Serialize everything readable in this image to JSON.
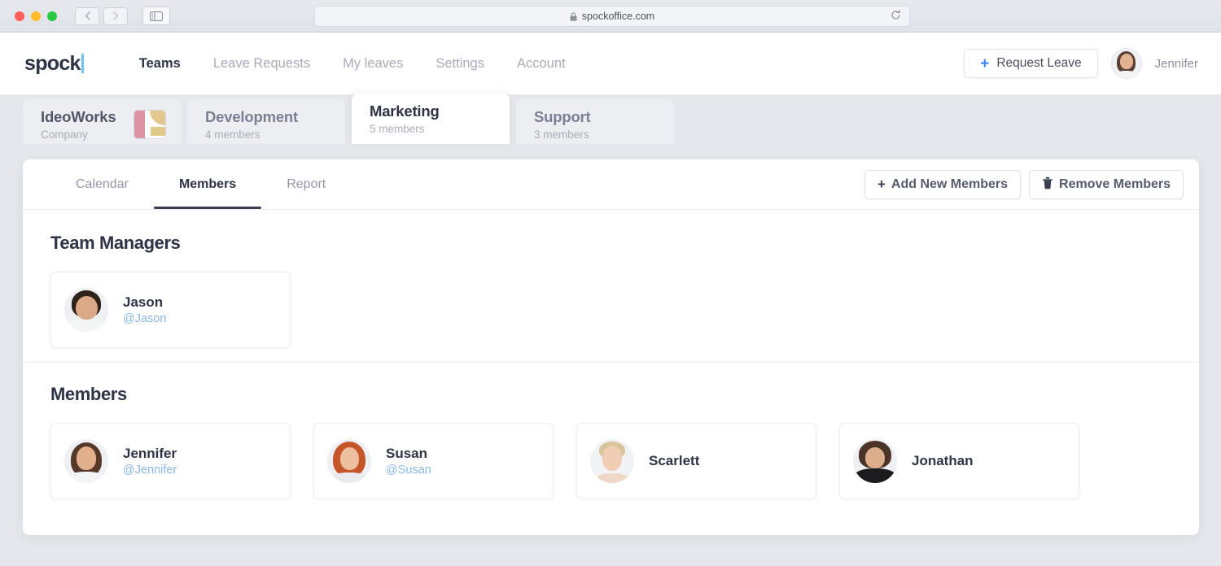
{
  "browser": {
    "url": "spockoffice.com",
    "lock_icon": "lock-icon",
    "reload_icon": "reload-icon",
    "back_icon": "chevron-left-icon",
    "forward_icon": "chevron-right-icon",
    "sidebar_icon": "sidebar-toggle-icon"
  },
  "header": {
    "logo": "spock",
    "nav": [
      {
        "label": "Teams",
        "active": true
      },
      {
        "label": "Leave Requests",
        "active": false
      },
      {
        "label": "My leaves",
        "active": false
      },
      {
        "label": "Settings",
        "active": false
      },
      {
        "label": "Account",
        "active": false
      }
    ],
    "request_leave_label": "Request Leave",
    "request_leave_icon": "plus-icon",
    "user_name": "Jennifer",
    "user_avatar": "avatar-jennifer"
  },
  "team_tabs": [
    {
      "name": "IdeoWorks",
      "sub": "Company",
      "active": false,
      "has_logo": true
    },
    {
      "name": "Development",
      "sub": "4 members",
      "active": false,
      "has_logo": false
    },
    {
      "name": "Marketing",
      "sub": "5 members",
      "active": true,
      "has_logo": false
    },
    {
      "name": "Support",
      "sub": "3 members",
      "active": false,
      "has_logo": false
    }
  ],
  "sub_tabs": [
    {
      "label": "Calendar",
      "active": false
    },
    {
      "label": "Members",
      "active": true
    },
    {
      "label": "Report",
      "active": false
    }
  ],
  "actions": {
    "add_label": "Add New Members",
    "add_icon": "plus-icon",
    "remove_label": "Remove Members",
    "remove_icon": "trash-icon"
  },
  "managers_section": {
    "title": "Team Managers",
    "people": [
      {
        "name": "Jason",
        "handle": "@Jason",
        "avatar": "avatar-jason"
      }
    ]
  },
  "members_section": {
    "title": "Members",
    "people": [
      {
        "name": "Jennifer",
        "handle": "@Jennifer",
        "avatar": "avatar-jennifer"
      },
      {
        "name": "Susan",
        "handle": "@Susan",
        "avatar": "avatar-susan"
      },
      {
        "name": "Scarlett",
        "handle": "",
        "avatar": "avatar-scarlett"
      },
      {
        "name": "Jonathan",
        "handle": "",
        "avatar": "avatar-jonathan"
      }
    ]
  },
  "colors": {
    "page_bg": "#e5e7ec",
    "accent_blue": "#3b82f6",
    "handle_blue": "#8ab8e8",
    "text_dark": "#2e3345",
    "text_muted": "#a8acb8",
    "logo_pink": "#dd93a3",
    "logo_tan": "#e3c88d"
  }
}
